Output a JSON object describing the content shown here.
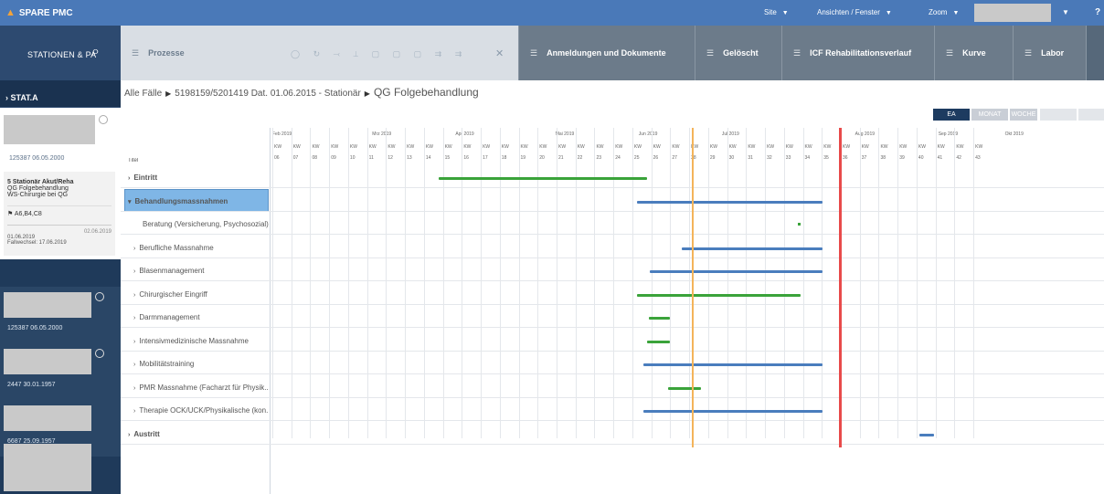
{
  "app": {
    "title": "SPARE PMC"
  },
  "topmenu": {
    "site": "Site",
    "view": "Ansichten / Fenster",
    "zoom": "Zoom"
  },
  "sidebar": {
    "search_label": "STATIONEN & PA",
    "station": "STAT.A",
    "selected_patient": {
      "meta": "125387 06.05.2000",
      "section_title": "5 Stationär Akut/Reha",
      "line1": "QG Folgebehandlung",
      "line2": "WS-Chirurgie bei QG",
      "flag": "A6,B4,C8",
      "date_right": "02.06.2019",
      "date_left": "01.06.2019",
      "fallwechsel": "Fallwechsel: 17.06.2019"
    },
    "others": [
      {
        "meta": "125387 06.05.2000"
      },
      {
        "meta": "2447 30.01.1957"
      },
      {
        "meta": "6687 25.09.1957"
      }
    ]
  },
  "tabs": [
    {
      "label": "Prozesse"
    },
    {
      "label": "Anmeldungen und Dokumente"
    },
    {
      "label": "Gelöscht"
    },
    {
      "label": "ICF Rehabilitationsverlauf"
    },
    {
      "label": "Kurve"
    },
    {
      "label": "Labor"
    }
  ],
  "breadcrumb": {
    "part1": "Alle Fälle",
    "part2": "5198159/5201419 Dat. 01.06.2015 - Stationär",
    "part3": "QG Folgebehandlung"
  },
  "views": {
    "ea": "EA",
    "monat": "MONAT",
    "woche": "WOCHE",
    "x1": "",
    "x2": ""
  },
  "gantt": {
    "title_col": "Titel",
    "months": [
      "Feb 2019",
      "Mrz 2019",
      "Apr 2019",
      "Mai 2019",
      "Jun 2019",
      "Jul 2019",
      "Aug 2019",
      "Sep 2019",
      "Okt 2019"
    ],
    "kw_label": "KW",
    "weeks": [
      "06",
      "07",
      "08",
      "09",
      "10",
      "11",
      "12",
      "13",
      "14",
      "15",
      "16",
      "17",
      "18",
      "19",
      "20",
      "21",
      "22",
      "23",
      "24",
      "25",
      "26",
      "27",
      "28",
      "29",
      "30",
      "31",
      "32",
      "33",
      "34",
      "35",
      "36",
      "37",
      "38",
      "39",
      "40",
      "41",
      "42",
      "43"
    ],
    "rows": [
      {
        "label": "Eintritt"
      },
      {
        "label": "Behandlungsmassnahmen"
      },
      {
        "label": "Beratung (Versicherung, Psychosozial)"
      },
      {
        "label": "Berufliche Massnahme"
      },
      {
        "label": "Blasenmanagement"
      },
      {
        "label": "Chirurgischer Eingriff"
      },
      {
        "label": "Darmmanagement"
      },
      {
        "label": "Intensivmedizinische Massnahme"
      },
      {
        "label": "Mobilitätstraining"
      },
      {
        "label": "PMR Massnahme (Facharzt für Physik..."
      },
      {
        "label": "Therapie OCK/UCK/Physikalische (kon..."
      },
      {
        "label": "Austritt"
      }
    ]
  },
  "colors": {
    "green": "#3aa33a",
    "blue": "#4a7dbd",
    "today": "#f4b45a",
    "red": "#e84a4a"
  }
}
